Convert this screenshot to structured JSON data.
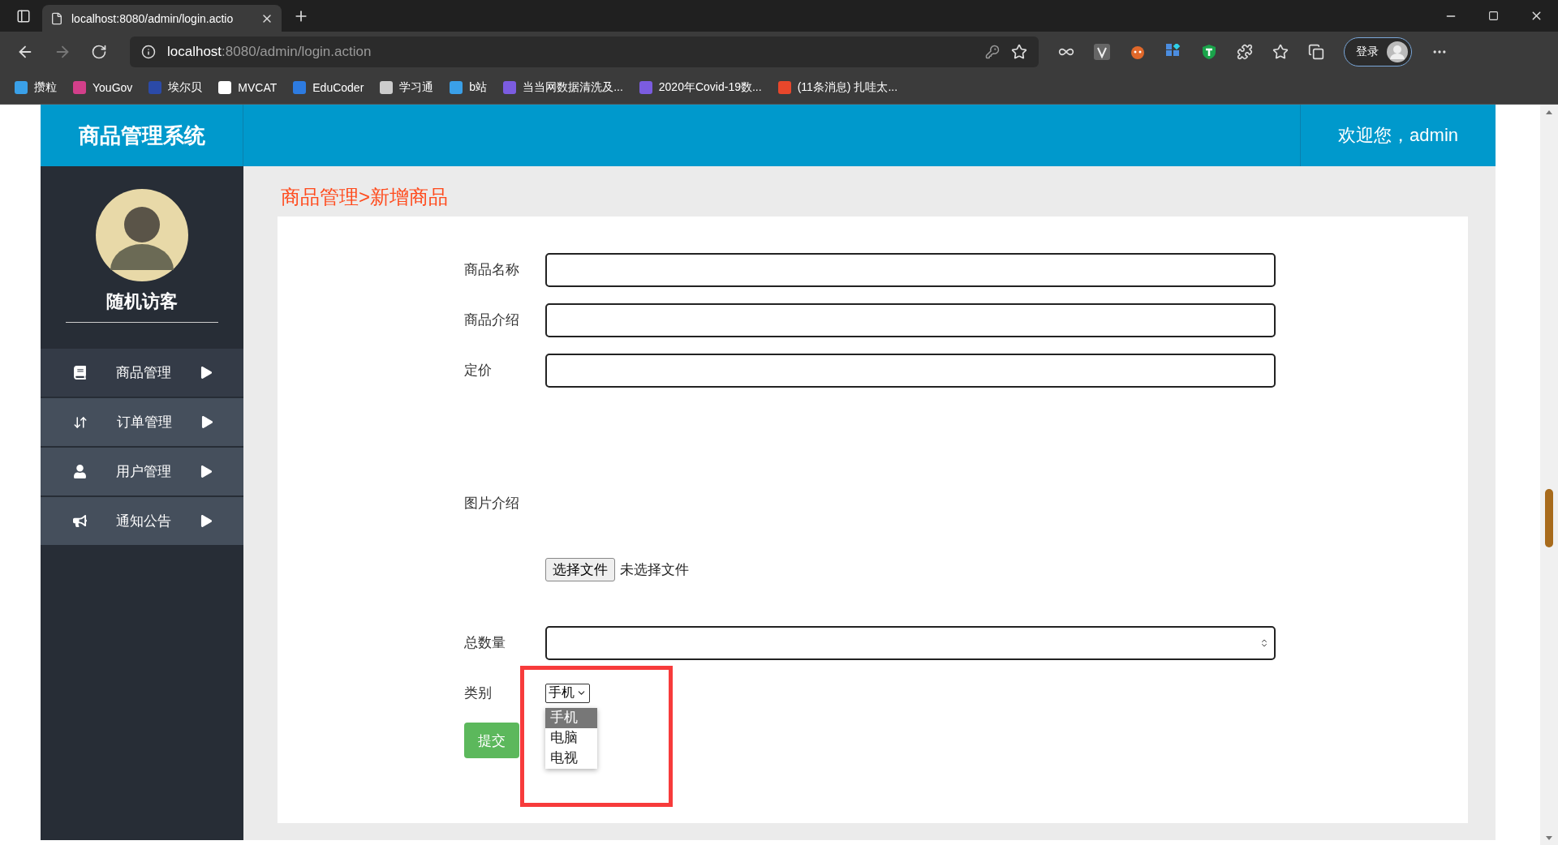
{
  "browser": {
    "tab": {
      "title": "localhost:8080/admin/login.actio"
    },
    "address": {
      "host": "localhost",
      "path": ":8080/admin/login.action"
    },
    "profile_button": "登录",
    "bookmarks": [
      {
        "label": "攒粒"
      },
      {
        "label": "YouGov"
      },
      {
        "label": "埃尔贝"
      },
      {
        "label": "MVCAT"
      },
      {
        "label": "EduCoder"
      },
      {
        "label": "学习通"
      },
      {
        "label": "b站"
      },
      {
        "label": "当当网数据清洗及..."
      },
      {
        "label": "2020年Covid-19数..."
      },
      {
        "label": "(11条消息) 扎哇太..."
      }
    ]
  },
  "app": {
    "title": "商品管理系统",
    "welcome": "欢迎您，admin",
    "user": {
      "name": "随机访客"
    },
    "menu": [
      {
        "label": "商品管理",
        "selected": true
      },
      {
        "label": "订单管理",
        "selected": false
      },
      {
        "label": "用户管理",
        "selected": false
      },
      {
        "label": "通知公告",
        "selected": false
      }
    ],
    "breadcrumb": "商品管理>新增商品",
    "form": {
      "fields": [
        {
          "label": "商品名称",
          "kind": "text"
        },
        {
          "label": "商品介绍",
          "kind": "text"
        },
        {
          "label": "定价",
          "kind": "text"
        },
        {
          "label": "图片介绍",
          "kind": "file",
          "button": "选择文件",
          "status": "未选择文件"
        },
        {
          "label": "总数量",
          "kind": "number"
        },
        {
          "label": "类别",
          "kind": "select",
          "value": "手机",
          "expanded": true,
          "options": [
            {
              "label": "手机",
              "selected": true
            },
            {
              "label": "电脑",
              "selected": false
            },
            {
              "label": "电视",
              "selected": false
            }
          ]
        }
      ],
      "submit": "提交"
    }
  }
}
